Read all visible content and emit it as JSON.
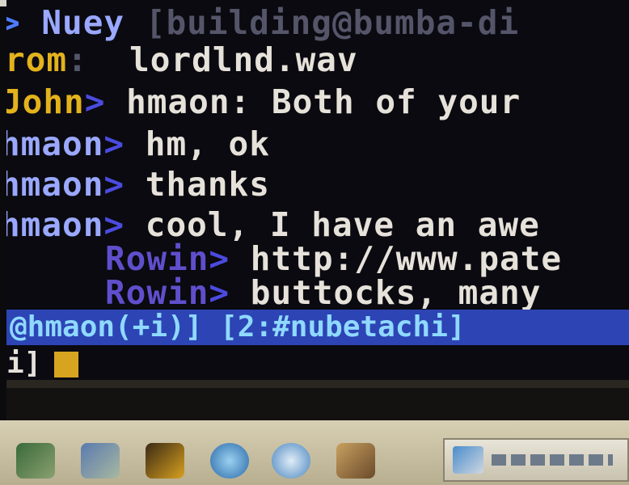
{
  "lines": [
    {
      "nick": "Nuey",
      "text": "[building@bumba-di"
    },
    {
      "nick": "rom",
      "sep": ":",
      "text": "lordlnd.wav"
    },
    {
      "nick": "John",
      "chevron": ">",
      "text": "hmaon: Both of your"
    },
    {
      "nick": "hmaon",
      "chevron": ">",
      "text": "hm, ok"
    },
    {
      "nick": "hmaon",
      "chevron": ">",
      "text": "thanks"
    },
    {
      "nick": "hmaon",
      "chevron": ">",
      "text": "cool, I have an awe"
    },
    {
      "nick": "Rowin",
      "chevron": ">",
      "text": "http://www.pate"
    },
    {
      "nick": "Rowin",
      "chevron": ">",
      "text": "buttocks, many"
    }
  ],
  "status": {
    "user": "@hmaon(+i)]",
    "window": "[2:#nubetachi]"
  },
  "prompt": {
    "text": "i]"
  },
  "colors": {
    "statusbar_bg": "#2d44b5",
    "nick_highlight": "#e3b21c",
    "chevron": "#4f7cff",
    "cursor": "#d7a420"
  },
  "taskbar_icons": [
    "fish-icon",
    "folder-icon",
    "irc-client-icon",
    "globe-icon",
    "network-icon",
    "pen-icon",
    "terminal-task-icon"
  ]
}
